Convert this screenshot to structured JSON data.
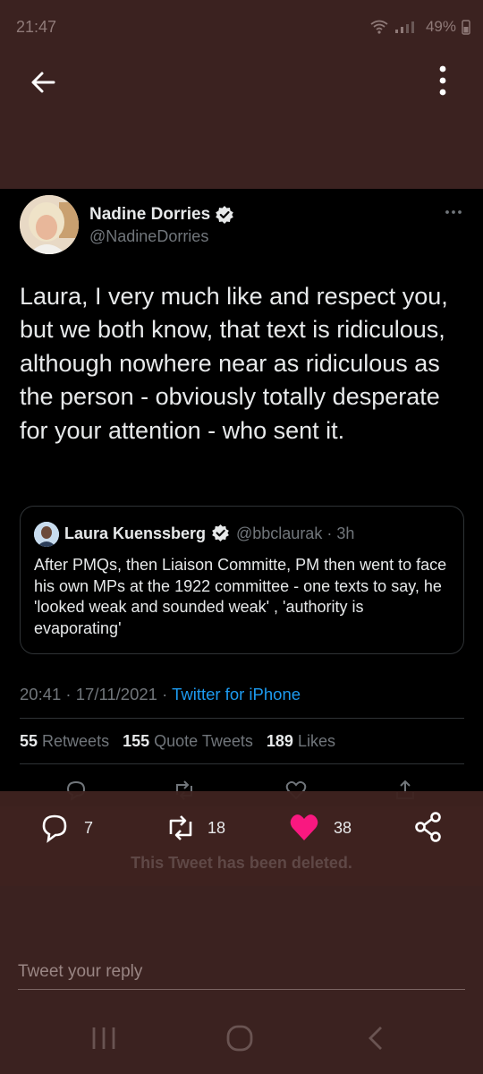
{
  "status_bar": {
    "time": "21:47",
    "battery": "49%"
  },
  "icons": {
    "back": "back-arrow-icon",
    "menu": "kebab-menu-icon",
    "verified": "verified-badge-icon",
    "reply": "reply-icon",
    "retweet": "retweet-icon",
    "like": "heart-icon",
    "share": "share-icon"
  },
  "tweet": {
    "author_name": "Nadine Dorries",
    "author_handle": "@NadineDorries",
    "text": "Laura, I very much like and respect you, but we both know, that text is ridiculous, although nowhere near as ridiculous as the person - obviously totally desperate for your attention - who sent it.",
    "timestamp": "20:41 · 17/11/2021 · ",
    "source": "Twitter for iPhone",
    "stats": {
      "retweets_count": "55",
      "retweets_label": " Retweets",
      "quotes_count": "155",
      "quotes_label": " Quote Tweets",
      "likes_count": "189",
      "likes_label": " Likes"
    }
  },
  "quoted_tweet": {
    "author_name": "Laura Kuenssberg",
    "author_handle": "@bbclaurak · 3h",
    "text": "After PMQs, then Liaison Committe, PM then went to face his own MPs at the 1922 committee - one texts to say, he 'looked weak and sounded weak' , 'authority is evaporating'"
  },
  "parent_tweet_actions": {
    "reply_count": "7",
    "retweet_count": "18",
    "like_count": "38",
    "deleted_notice": "This Tweet has been deleted."
  },
  "reply": {
    "placeholder": "Tweet your reply"
  },
  "colors": {
    "background": "#3b2220",
    "tweet_bg": "#000000",
    "link": "#1d9bf0",
    "like_pink": "#f91880",
    "verified": "#e7e9ea"
  }
}
